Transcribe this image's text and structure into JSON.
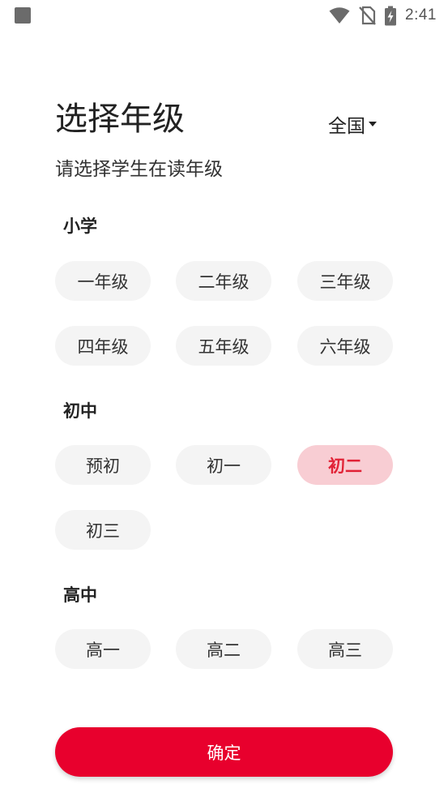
{
  "status_bar": {
    "time": "2:41",
    "icons": [
      "notification-square-icon",
      "wifi-icon",
      "no-sim-icon",
      "battery-charging-icon"
    ]
  },
  "header": {
    "title": "选择年级",
    "region": "全国",
    "subtitle": "请选择学生在读年级"
  },
  "sections": {
    "primary": {
      "title": "小学",
      "grades": [
        "一年级",
        "二年级",
        "三年级",
        "四年级",
        "五年级",
        "六年级"
      ]
    },
    "junior": {
      "title": "初中",
      "grades": [
        "预初",
        "初一",
        "初二",
        "初三"
      ]
    },
    "senior": {
      "title": "高中",
      "grades": [
        "高一",
        "高二",
        "高三"
      ]
    }
  },
  "selected_grade": "初二",
  "confirm_label": "确定",
  "colors": {
    "accent": "#e8002d",
    "selected_bg": "#f8cdd3",
    "selected_text": "#e12236",
    "chip_bg": "#f4f4f4"
  }
}
